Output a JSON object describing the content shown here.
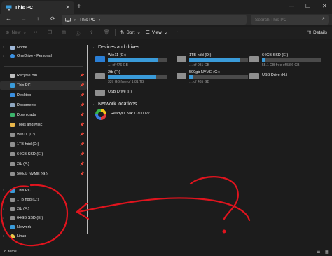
{
  "window": {
    "tab_title": "This PC",
    "tab_close_glyph": "✕",
    "new_tab_glyph": "+",
    "controls": [
      "—",
      "☐",
      "✕"
    ]
  },
  "nav": {
    "back_glyph": "←",
    "forward_glyph": "→",
    "up_glyph": "↑",
    "refresh_glyph": "⟳",
    "breadcrumb": [
      "This PC",
      "›"
    ],
    "search_placeholder": "Search This PC",
    "search_glyph": "⌕"
  },
  "toolbar": {
    "new_label": "New",
    "sort_label": "Sort",
    "view_label": "View",
    "more_label": "···",
    "details_label": "Details"
  },
  "sidebar": {
    "top_items": [
      {
        "label": "Home",
        "icon": "home-icon",
        "color": "#9fb8d8"
      },
      {
        "label": "OneDrive - Personal",
        "icon": "cloud-icon",
        "color": "#3a8fe0"
      }
    ],
    "quick_access": [
      {
        "label": "Recycle Bin",
        "icon": "recycle-bin-icon",
        "color": "#bdbdbd"
      },
      {
        "label": "This PC",
        "icon": "computer-icon",
        "color": "#3a9bd9"
      },
      {
        "label": "Desktop",
        "icon": "desktop-icon",
        "color": "#3a8fe0"
      },
      {
        "label": "Documents",
        "icon": "documents-icon",
        "color": "#8fa6bf"
      },
      {
        "label": "Downloads",
        "icon": "downloads-icon",
        "color": "#3bb36b"
      },
      {
        "label": "Tools and Misc",
        "icon": "folder-icon",
        "color": "#e8b64a"
      },
      {
        "label": "Win11 (C:)",
        "icon": "drive-icon",
        "color": "#8f8f8f"
      },
      {
        "label": "1TB hdd (D:)",
        "icon": "drive-icon",
        "color": "#8f8f8f"
      },
      {
        "label": "64GB SSD (E:)",
        "icon": "drive-icon",
        "color": "#8f8f8f"
      },
      {
        "label": "2tb (F:)",
        "icon": "drive-icon",
        "color": "#8f8f8f"
      },
      {
        "label": "500gb NVME (G:)",
        "icon": "drive-icon",
        "color": "#8f8f8f"
      }
    ],
    "tree": [
      {
        "label": "This PC",
        "icon": "computer-icon",
        "color": "#3a9bd9"
      },
      {
        "label": "1TB hdd (D:)",
        "icon": "drive-icon",
        "color": "#8f8f8f"
      },
      {
        "label": "2tb (F:)",
        "icon": "drive-icon",
        "color": "#8f8f8f"
      },
      {
        "label": "64GB SSD (E:)",
        "icon": "drive-icon",
        "color": "#8f8f8f"
      },
      {
        "label": "Network",
        "icon": "network-icon",
        "color": "#3a9bd9"
      },
      {
        "label": "Linux",
        "icon": "linux-icon",
        "color": "#e8c84a"
      }
    ]
  },
  "content": {
    "devices_header": "Devices and drives",
    "network_header": "Network locations",
    "drives": [
      {
        "name": "Win11 (C:)",
        "free": "… of 476 GB",
        "used_fraction": 0.85,
        "has_bar": true,
        "icon": "windows-drive-icon"
      },
      {
        "name": "1TB hdd (D:)",
        "free": "… of 931 GB",
        "used_fraction": 0.86,
        "has_bar": true,
        "icon": "drive-icon"
      },
      {
        "name": "64GB SSD (E:)",
        "free": "55.1 GB free of 58.6 GB",
        "used_fraction": 0.06,
        "has_bar": true,
        "icon": "drive-icon"
      },
      {
        "name": "2tb (F:)",
        "free": "337 GB free of 1.81 TB",
        "used_fraction": 0.82,
        "has_bar": true,
        "icon": "drive-icon"
      },
      {
        "name": "500gb NVME (G:)",
        "free": "… of 465 GB",
        "used_fraction": 0.06,
        "has_bar": true,
        "icon": "drive-icon"
      },
      {
        "name": "USB Drive (H:)",
        "free": "",
        "used_fraction": 0,
        "has_bar": false,
        "icon": "usb-drive-icon"
      },
      {
        "name": "USB Drive (I:)",
        "free": "",
        "used_fraction": 0,
        "has_bar": false,
        "icon": "usb-drive-icon"
      }
    ],
    "network_devices": [
      {
        "name": "ReadyDLNA: C7000v2",
        "icon": "media-server-icon"
      }
    ]
  },
  "status": {
    "item_count": "8 items"
  },
  "colors": {
    "accent": "#3a9bd9",
    "annotation": "#e0141e"
  }
}
